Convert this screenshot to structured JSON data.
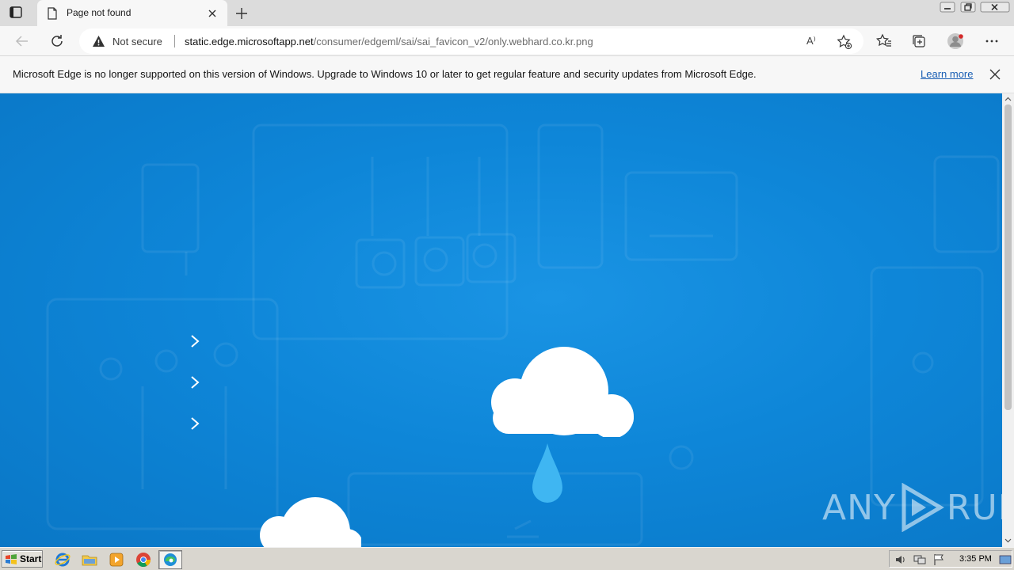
{
  "browser": {
    "tab": {
      "title": "Page not found"
    },
    "address": {
      "security_label": "Not secure",
      "url_host": "static.edge.microsoftapp.net",
      "url_path": "/consumer/edgeml/sai/sai_favicon_v2/only.webhard.co.kr.png"
    },
    "read_aloud_glyph": "A⁾"
  },
  "infobar": {
    "message": "Microsoft Edge is no longer supported on this version of Windows. Upgrade to Windows 10 or later to get regular feature and security updates from Microsoft Edge.",
    "link_label": "Learn more"
  },
  "page": {
    "background_color": "#0f86d8",
    "cloud_color": "#ffffff",
    "drop_color": "#3fb6f2"
  },
  "watermark": {
    "text": "ANY",
    "text2": "RUN"
  },
  "taskbar": {
    "start_label": "Start",
    "clock": "3:35 PM",
    "apps": [
      "ie-icon",
      "explorer-folder-icon",
      "media-player-icon",
      "chrome-icon",
      "edge-icon"
    ]
  }
}
